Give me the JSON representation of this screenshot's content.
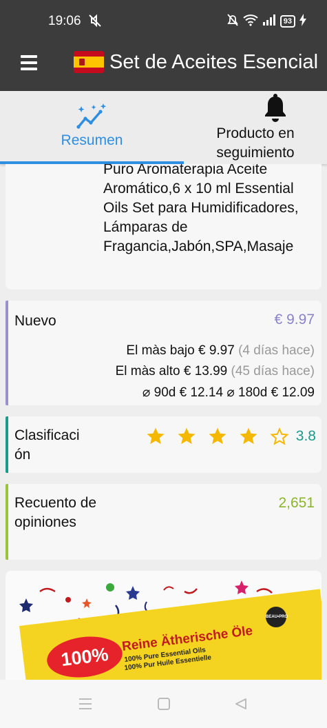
{
  "status_bar": {
    "time": "19:06",
    "battery": "93",
    "icons": [
      "mute-icon",
      "dnd-icon",
      "wifi-icon",
      "signal-icon",
      "battery-icon",
      "charging-icon"
    ]
  },
  "app_bar": {
    "menu_icon": "hamburger-menu-icon",
    "flag": "spain-flag-icon",
    "title": "Set de Aceites Esencial"
  },
  "tabs": [
    {
      "label": "Resumen",
      "icon": "trend-sparkle-icon",
      "active": true
    },
    {
      "label": "Producto en seguimiento",
      "icon": "bell-icon",
      "active": false
    }
  ],
  "product": {
    "title": "Puro Aromaterapia Aceite Aromático,6 x 10 ml Essential Oils Set para Humidificadores, Lámparas de Fragancia,Jabón,SPA,Masaje"
  },
  "price": {
    "label": "Nuevo",
    "current": "€ 9.97",
    "lowest_label": "El màs bajo",
    "lowest_value": "€ 9.97",
    "lowest_when": "(4 días hace)",
    "highest_label": "El màs alto",
    "highest_value": "€ 13.99",
    "highest_when": "(45 días hace)",
    "avg90_label": "⌀ 90d",
    "avg90_value": "€ 12.14",
    "avg180_label": "⌀ 180d",
    "avg180_value": "€ 12.09",
    "accent": "#9891cc"
  },
  "rating": {
    "label": "Clasificaci\nón",
    "value": "3.8",
    "stars_filled": 4,
    "stars_total": 5,
    "accent": "#1d9a8a",
    "star_color": "#f5b800"
  },
  "reviews": {
    "label": "Recuento de opiniones",
    "value": "2,651",
    "accent": "#9ac23c"
  },
  "product_image": {
    "badge": "100%",
    "title": "Reine Ätherische Öle",
    "line1": "100% Pure Essential Oils",
    "line2": "100% Pur Huile Essentielle",
    "brand": "BEAU•PRO"
  },
  "nav_bar": {
    "icons": [
      "recents-icon",
      "home-icon",
      "back-icon"
    ]
  }
}
